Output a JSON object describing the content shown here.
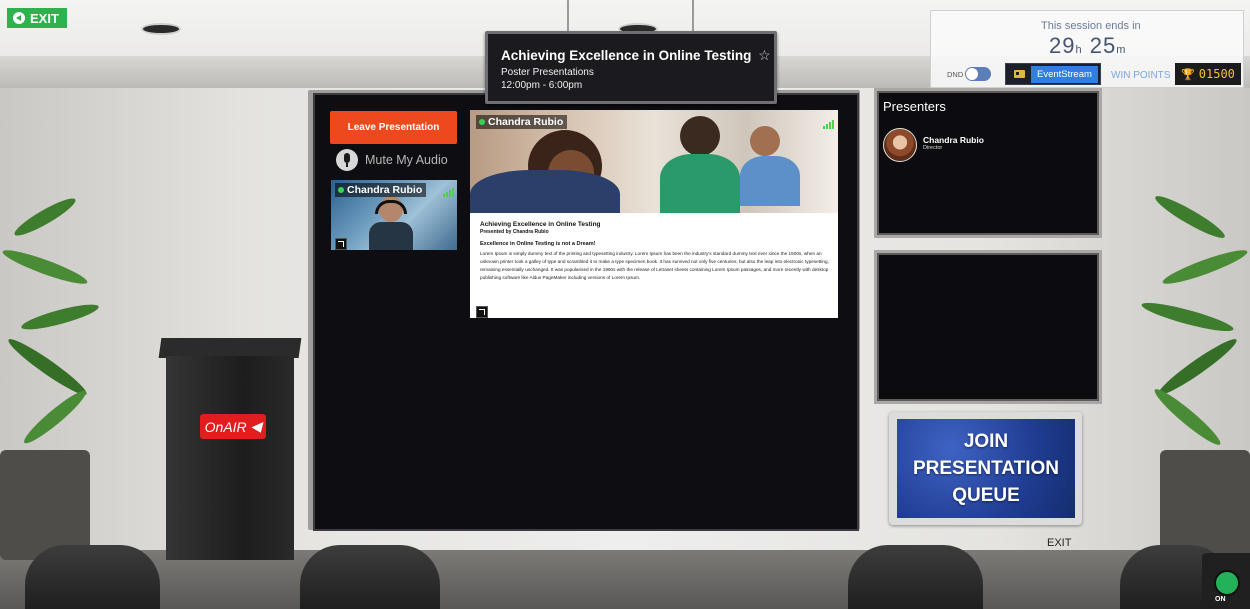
{
  "app": {
    "exit_label": "EXIT",
    "exit_lower_label": "EXIT"
  },
  "sign": {
    "title": "Achieving Excellence in Online Testing",
    "star_icon": "☆",
    "subtitle": "Poster Presentations",
    "time": "12:00pm - 6:00pm"
  },
  "session": {
    "label": "This session ends in",
    "hours": "29",
    "hours_unit": "h",
    "minutes": "25",
    "minutes_unit": "m",
    "dnd_label": "DND",
    "event_stream_label": "EventStream",
    "win_points_label": "WIN POINTS",
    "win_points_value": "01500"
  },
  "controls": {
    "leave_label": "Leave Presentation",
    "mute_label": "Mute My Audio"
  },
  "video": {
    "name": "Chandra Rubio"
  },
  "presentation": {
    "name": "Chandra Rubio",
    "title": "Achieving Excellence in Online Testing",
    "presented_by": "Presented by Chandra Rubio",
    "heading": "Excellence in Online Testing is not a Dream!",
    "body": "Lorem Ipsum is simply dummy text of the printing and typesetting industry. Lorem Ipsum has been the industry's standard dummy text ever since the 1500s, when an unknown printer took a galley of type and scrambled it to make a type specimen book. It has survived not only five centuries, but also the leap into electronic typesetting, remaining essentially unchanged. It was popularised in the 1960s with the release of Letraset sheets containing Lorem Ipsum passages, and more recently with desktop publishing software like Aldus PageMaker including versions of Lorem Ipsum."
  },
  "presenters": {
    "title": "Presenters",
    "items": [
      {
        "name": "Chandra Rubio",
        "role": "Director"
      }
    ]
  },
  "join": {
    "line1": "JOIN",
    "line2": "PRESENTATION",
    "line3": "QUEUE"
  },
  "podium": {
    "logo": "OnAIR"
  },
  "on_button": {
    "label": "ON"
  }
}
